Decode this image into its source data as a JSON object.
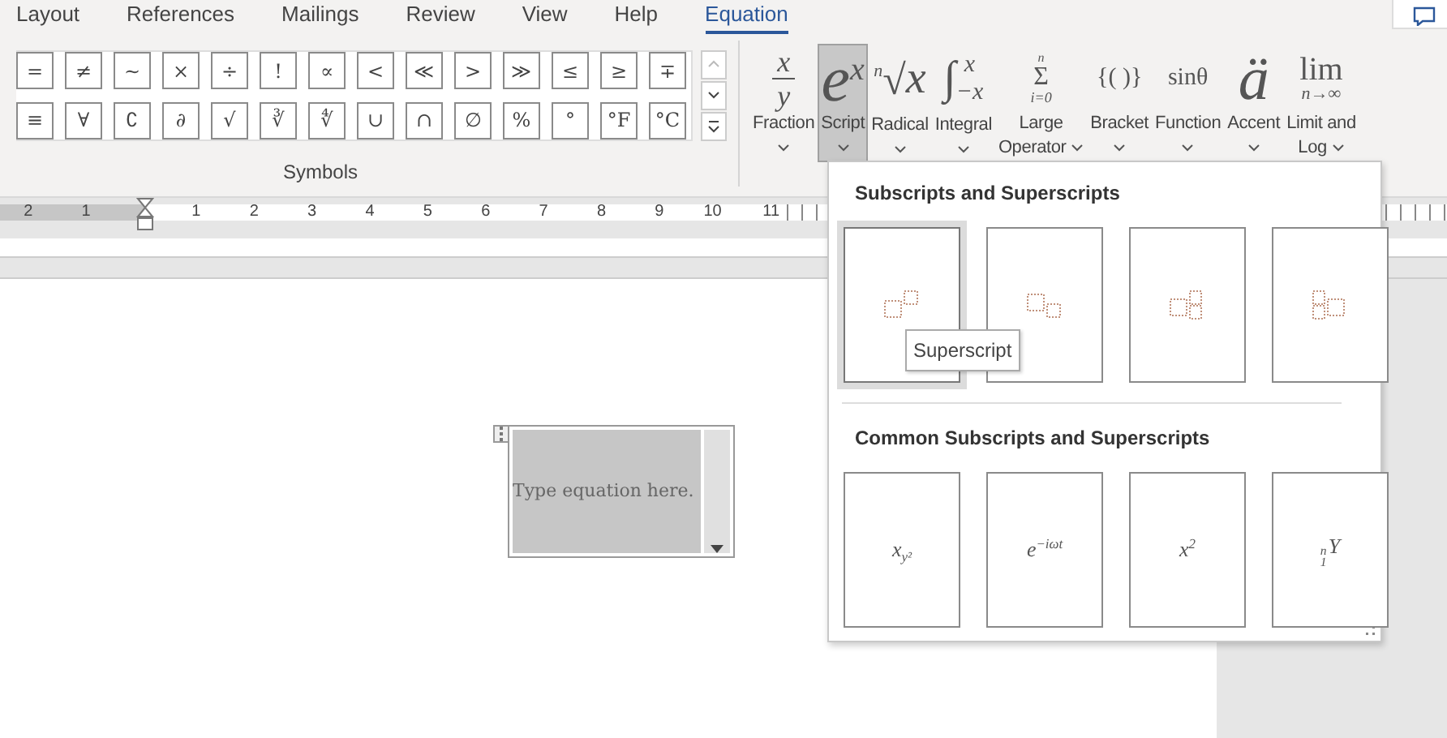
{
  "tabs": [
    {
      "label": "Layout",
      "selected": false
    },
    {
      "label": "References",
      "selected": false
    },
    {
      "label": "Mailings",
      "selected": false
    },
    {
      "label": "Review",
      "selected": false
    },
    {
      "label": "View",
      "selected": false
    },
    {
      "label": "Help",
      "selected": false
    },
    {
      "label": "Equation",
      "selected": true
    }
  ],
  "symbols": {
    "rows": [
      [
        "=",
        "≠",
        "~",
        "×",
        "÷",
        "!",
        "∝",
        "<",
        "≪",
        ">",
        "≫",
        "≤",
        "≥",
        "∓"
      ],
      [
        "≡",
        "∀",
        "∁",
        "∂",
        "√",
        "∛",
        "∜",
        "∪",
        "∩",
        "∅",
        "%",
        "°",
        "°F",
        "°C"
      ]
    ],
    "group_label": "Symbols"
  },
  "tools": [
    {
      "kind": "fraction",
      "parts": [
        "x",
        "y"
      ],
      "label": [
        "Fraction"
      ],
      "selected": false
    },
    {
      "kind": "script",
      "parts": [
        "e",
        "x"
      ],
      "label": [
        "Script"
      ],
      "selected": true
    },
    {
      "kind": "radical",
      "parts": [
        "n",
        "√",
        "x"
      ],
      "label": [
        "Radical"
      ],
      "selected": false
    },
    {
      "kind": "integral",
      "parts": [
        "∫",
        "x",
        "−x"
      ],
      "label": [
        "Integral"
      ],
      "selected": false
    },
    {
      "kind": "large_operator",
      "parts": [
        "n",
        "Σ",
        "i=0"
      ],
      "label": [
        "Large",
        "Operator"
      ],
      "selected": false
    },
    {
      "kind": "plain",
      "parts": [
        "{( )}"
      ],
      "label": [
        "Bracket"
      ],
      "selected": false
    },
    {
      "kind": "plain",
      "parts": [
        "sinθ"
      ],
      "label": [
        "Function"
      ],
      "selected": false
    },
    {
      "kind": "accent",
      "parts": [
        "ä"
      ],
      "label": [
        "Accent"
      ],
      "selected": false
    },
    {
      "kind": "limit",
      "parts": [
        "lim",
        "n→∞"
      ],
      "label": [
        "Limit and",
        "Log"
      ],
      "selected": false
    }
  ],
  "ruler": {
    "left_numbers": [
      "2",
      "1"
    ],
    "right_numbers": [
      "1",
      "2",
      "3",
      "4",
      "5",
      "6",
      "7",
      "8",
      "9",
      "10",
      "11"
    ]
  },
  "equation": {
    "text": "Type equation here."
  },
  "gallery": {
    "sections": [
      {
        "title": "Subscripts and Superscripts",
        "items": [
          {
            "kind": "superscript",
            "selected": true
          },
          {
            "kind": "subscript",
            "selected": false
          },
          {
            "kind": "sub_sup",
            "selected": false
          },
          {
            "kind": "left_sub_sup",
            "selected": false
          }
        ]
      },
      {
        "title": "Common Subscripts and Superscripts",
        "items": [
          {
            "kind": "sub",
            "base": "x",
            "sub": "y²",
            "selected": false
          },
          {
            "kind": "sup",
            "base": "e",
            "sup": "−iωt",
            "selected": false
          },
          {
            "kind": "sup",
            "base": "x",
            "sup": "2",
            "selected": false
          },
          {
            "kind": "pre",
            "base": "Y",
            "sup": "n",
            "sub": "1",
            "selected": false
          }
        ]
      }
    ],
    "tooltip": "Superscript"
  }
}
